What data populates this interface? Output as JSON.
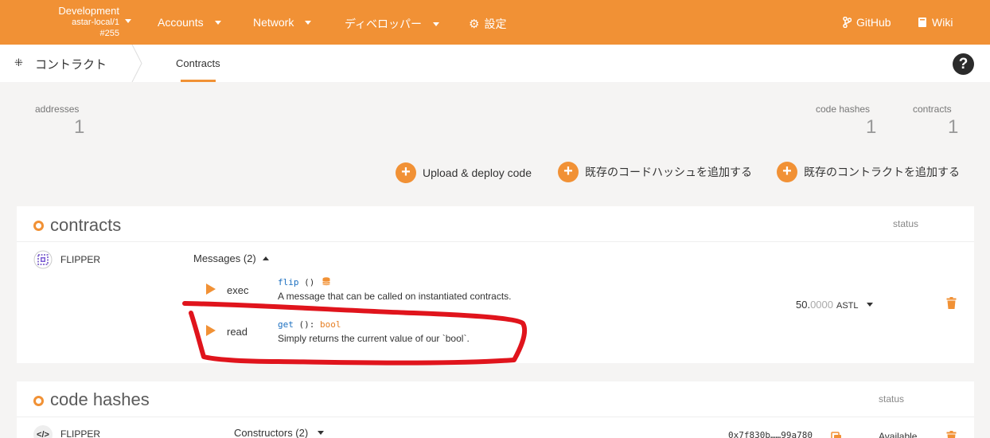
{
  "topnav": {
    "chain": {
      "name": "Development",
      "node": "astar-local/1",
      "block": "#255"
    },
    "accounts": "Accounts",
    "network": "Network",
    "developer": "ディベロッパー",
    "settings": "設定",
    "github": "GitHub",
    "wiki": "Wiki"
  },
  "subheader": {
    "section": "コントラクト",
    "tab": "Contracts",
    "help": "?"
  },
  "summary": {
    "addresses_label": "addresses",
    "addresses_value": "1",
    "code_hashes_label": "code hashes",
    "code_hashes_value": "1",
    "contracts_label": "contracts",
    "contracts_value": "1"
  },
  "actions": {
    "upload": "Upload & deploy code",
    "add_hash": "既存のコードハッシュを追加する",
    "add_contract": "既存のコントラクトを追加する"
  },
  "contracts": {
    "title": "contracts",
    "status_label": "status",
    "item": {
      "name": "FLIPPER",
      "messages_label": "Messages (2)",
      "balance_int": "50.",
      "balance_dec": "0000",
      "balance_unit": "ASTL",
      "messages": [
        {
          "kind": "exec",
          "sig_name": "flip",
          "sig_args": " ()",
          "ret": "",
          "doc": "A message that can be called on instantiated contracts."
        },
        {
          "kind": "read",
          "sig_name": "get",
          "sig_args": " ():",
          "ret": " bool",
          "doc": "Simply returns the current value of our `bool`."
        }
      ]
    }
  },
  "code_hashes": {
    "title": "code hashes",
    "status_label": "status",
    "item": {
      "name": "FLIPPER",
      "constructors_label": "Constructors (2)",
      "hash": "0x7f830b……99a780",
      "status": "Available"
    }
  },
  "colors": {
    "accent": "#f19135",
    "annotation": "#e0141c"
  }
}
